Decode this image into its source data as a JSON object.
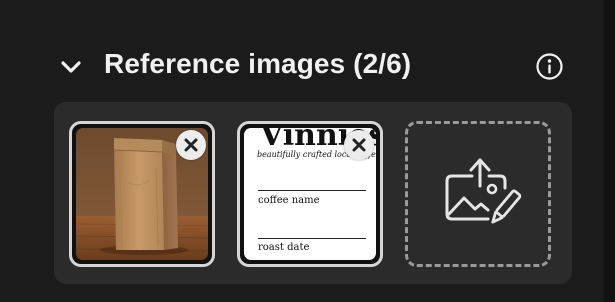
{
  "section": {
    "title": "Reference images (2/6)"
  },
  "images": [
    {
      "name": "kraft paper coffee bag"
    },
    {
      "name": "coffee label",
      "brand": "Vinnies",
      "tagline": "beautifully crafted local coffee",
      "field_1": "coffee name",
      "field_2": "roast date"
    }
  ],
  "upload_slot": {
    "icon": "image-upload-icon"
  },
  "icons": {
    "collapse": "chevron-down-icon",
    "info": "info-icon",
    "remove": "close-icon"
  },
  "colors": {
    "background": "#1b1b1b",
    "panel": "#2b2b2b",
    "text": "#f1f1f1",
    "thumb_border": "#d6d6d6"
  }
}
